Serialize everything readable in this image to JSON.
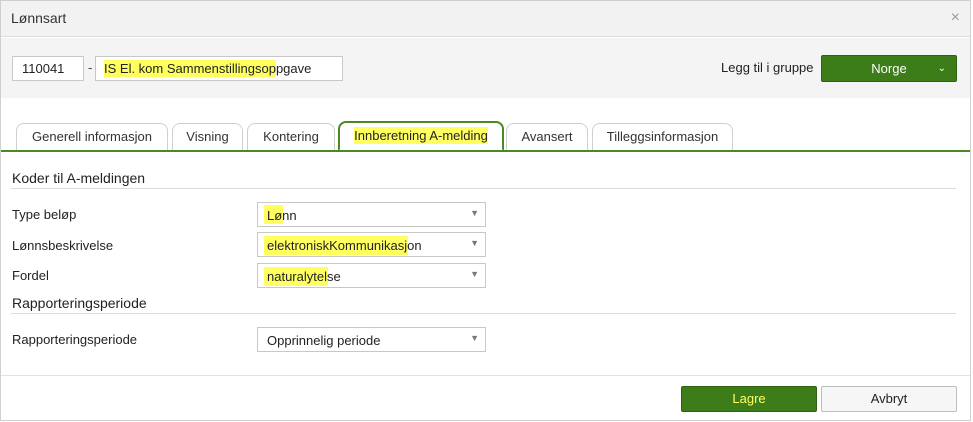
{
  "dialog": {
    "title": "Lønnsart",
    "close_glyph": "×"
  },
  "header": {
    "code": "110041",
    "separator": "-",
    "name": "IS El. kom Sammenstillingsoppgave",
    "group_label": "Legg til i gruppe",
    "group_button": "Norge"
  },
  "tabs": [
    {
      "label": "Generell informasjon",
      "active": false
    },
    {
      "label": "Visning",
      "active": false
    },
    {
      "label": "Kontering",
      "active": false
    },
    {
      "label": "Innberetning A-melding",
      "active": true
    },
    {
      "label": "Avansert",
      "active": false
    },
    {
      "label": "Tilleggsinformasjon",
      "active": false
    }
  ],
  "section_codes": {
    "title": "Koder til A-meldingen",
    "rows": [
      {
        "label": "Type beløp",
        "value": "Lønn"
      },
      {
        "label": "Lønnsbeskrivelse",
        "value": "elektroniskKommunikasjon"
      },
      {
        "label": "Fordel",
        "value": "naturalytelse"
      }
    ]
  },
  "section_period": {
    "title": "Rapporteringsperiode",
    "rows": [
      {
        "label": "Rapporteringsperiode",
        "value": "Opprinnelig periode"
      }
    ]
  },
  "footer": {
    "save_label": "Lagre",
    "cancel_label": "Avbryt"
  },
  "colors": {
    "accent_green": "#3d7d19",
    "highlight_yellow": "#ffff60"
  }
}
